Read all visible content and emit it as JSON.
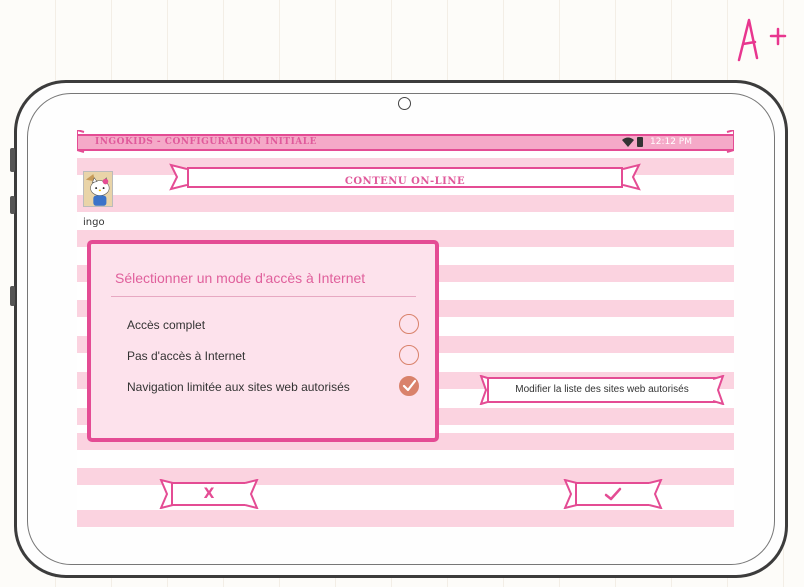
{
  "app": {
    "title": "INGOKIDS - CONFIGURATION INITIALE",
    "time": "12:12 PM"
  },
  "header": {
    "title": "CONTENU ON-LINE"
  },
  "user": {
    "name": "ingo",
    "avatar_icon": "hello-kitty-avatar"
  },
  "access_panel": {
    "title": "Sélectionner un mode d'accès à Internet",
    "options": [
      {
        "label": "Accès complet",
        "selected": false
      },
      {
        "label": "Pas d'accès à Internet",
        "selected": false
      },
      {
        "label": "Navigation limitée aux sites web autorisés",
        "selected": true
      }
    ]
  },
  "modify_button": {
    "label": "Modifier la liste des sites web autorisés"
  },
  "footer": {
    "cancel_label": "X",
    "confirm_icon": "checkmark-icon"
  },
  "decoration": {
    "grade": "A+"
  },
  "colors": {
    "accent": "#e44c94",
    "stripe": "#fbd3e0",
    "panel_bg": "#fde2ec",
    "radio": "#d9826b"
  }
}
